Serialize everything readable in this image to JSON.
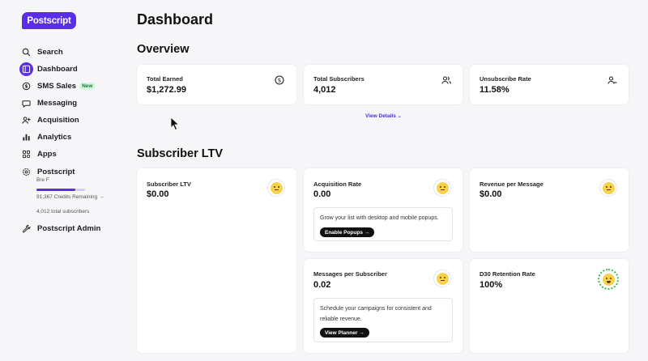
{
  "brand": {
    "logo_text": "Postscript",
    "accent": "#5a2ee6"
  },
  "sidebar": {
    "items": [
      {
        "label": "Search",
        "icon": "search-icon"
      },
      {
        "label": "Dashboard",
        "icon": "dashboard-icon",
        "active": true
      },
      {
        "label": "SMS Sales",
        "icon": "dollar-icon",
        "badge": "New"
      },
      {
        "label": "Messaging",
        "icon": "message-icon"
      },
      {
        "label": "Acquisition",
        "icon": "acquisition-icon"
      },
      {
        "label": "Analytics",
        "icon": "analytics-icon"
      },
      {
        "label": "Apps",
        "icon": "apps-icon"
      },
      {
        "label": "Postscript",
        "icon": "gear-icon"
      },
      {
        "label": "Postscript Admin",
        "icon": "wrench-icon"
      }
    ],
    "account": {
      "user": "Bre F",
      "credits": "91,367 Credits Remaining →",
      "credits_fraction": 0.8,
      "subscribers": "4,012 total subscribers"
    }
  },
  "main": {
    "page_title": "Dashboard",
    "overview": {
      "heading": "Overview",
      "cards": [
        {
          "title": "Total Earned",
          "value": "$1,272.99",
          "icon": "dollar-circle-icon"
        },
        {
          "title": "Total Subscribers",
          "value": "4,012",
          "icon": "users-icon"
        },
        {
          "title": "Unsubscribe Rate",
          "value": "11.58%",
          "icon": "user-minus-icon"
        }
      ],
      "view_details": "View Details ⌄"
    },
    "ltv": {
      "heading": "Subscriber LTV",
      "cards": [
        {
          "title": "Subscriber LTV",
          "value": "$0.00"
        },
        {
          "title": "Acquisition Rate",
          "value": "0.00",
          "hint": "Grow your list with desktop and mobile popups.",
          "button": "Enable Popups →"
        },
        {
          "title": "Revenue per Message",
          "value": "$0.00"
        },
        {
          "title": "Messages per Subscriber",
          "value": "0.02",
          "hint": "Schedule your campaigns for consistent and reliable revenue.",
          "button": "View Planner →"
        },
        {
          "title": "D30 Retention Rate",
          "value": "100%"
        }
      ]
    }
  }
}
